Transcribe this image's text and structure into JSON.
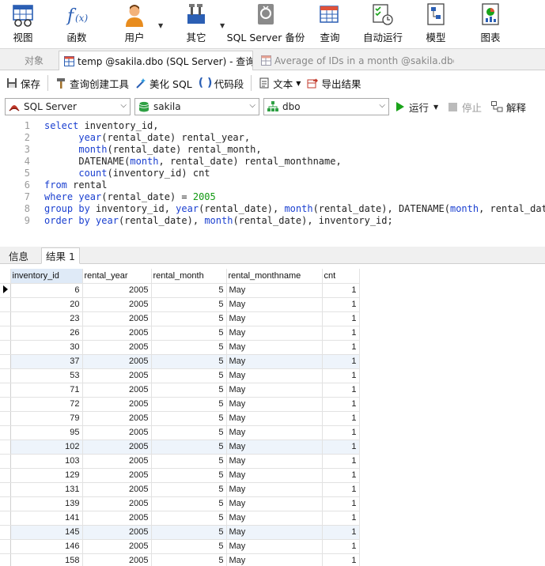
{
  "ribbon": {
    "items": [
      {
        "label": "视图",
        "icon": "view-icon"
      },
      {
        "label": "函数",
        "icon": "function-icon"
      },
      {
        "label": "用户",
        "icon": "user-icon"
      },
      {
        "label": "其它",
        "icon": "tools-icon"
      },
      {
        "label": "SQL Server 备份",
        "icon": "backup-icon"
      },
      {
        "label": "查询",
        "icon": "query-icon"
      },
      {
        "label": "自动运行",
        "icon": "autorun-icon"
      },
      {
        "label": "模型",
        "icon": "model-icon"
      },
      {
        "label": "图表",
        "icon": "chart-icon"
      }
    ]
  },
  "tabs": [
    {
      "label": "对象"
    },
    {
      "label": "temp @sakila.dbo (SQL Server) - 查询"
    },
    {
      "label": "Average of IDs in a month @sakila.dbo (..."
    }
  ],
  "toolbar": {
    "save": "保存",
    "query_builder": "查询创建工具",
    "beautify": "美化 SQL",
    "snippet": "代码段",
    "text": "文本",
    "export": "导出结果"
  },
  "connection": {
    "server": "SQL Server",
    "database": "sakila",
    "schema": "dbo",
    "run": "运行",
    "stop": "停止",
    "explain": "解释"
  },
  "editor": {
    "line_numbers": [
      "1",
      "2",
      "3",
      "4",
      "5",
      "6",
      "7",
      "8",
      "9"
    ]
  },
  "results": {
    "tabs": [
      "信息",
      "结果 1"
    ],
    "columns": [
      "inventory_id",
      "rental_year",
      "rental_month",
      "rental_monthname",
      "cnt"
    ],
    "rows": [
      [
        "6",
        "2005",
        "5",
        "May",
        "1"
      ],
      [
        "20",
        "2005",
        "5",
        "May",
        "1"
      ],
      [
        "23",
        "2005",
        "5",
        "May",
        "1"
      ],
      [
        "26",
        "2005",
        "5",
        "May",
        "1"
      ],
      [
        "30",
        "2005",
        "5",
        "May",
        "1"
      ],
      [
        "37",
        "2005",
        "5",
        "May",
        "1"
      ],
      [
        "53",
        "2005",
        "5",
        "May",
        "1"
      ],
      [
        "71",
        "2005",
        "5",
        "May",
        "1"
      ],
      [
        "72",
        "2005",
        "5",
        "May",
        "1"
      ],
      [
        "79",
        "2005",
        "5",
        "May",
        "1"
      ],
      [
        "95",
        "2005",
        "5",
        "May",
        "1"
      ],
      [
        "102",
        "2005",
        "5",
        "May",
        "1"
      ],
      [
        "103",
        "2005",
        "5",
        "May",
        "1"
      ],
      [
        "129",
        "2005",
        "5",
        "May",
        "1"
      ],
      [
        "131",
        "2005",
        "5",
        "May",
        "1"
      ],
      [
        "139",
        "2005",
        "5",
        "May",
        "1"
      ],
      [
        "141",
        "2005",
        "5",
        "May",
        "1"
      ],
      [
        "145",
        "2005",
        "5",
        "May",
        "1"
      ],
      [
        "146",
        "2005",
        "5",
        "May",
        "1"
      ],
      [
        "158",
        "2005",
        "5",
        "May",
        "1"
      ]
    ]
  },
  "colors": {
    "keyword": "#1a3fd0",
    "number": "#119911",
    "selected_header": "#dfeaf7",
    "run_green": "#1aa31a"
  }
}
